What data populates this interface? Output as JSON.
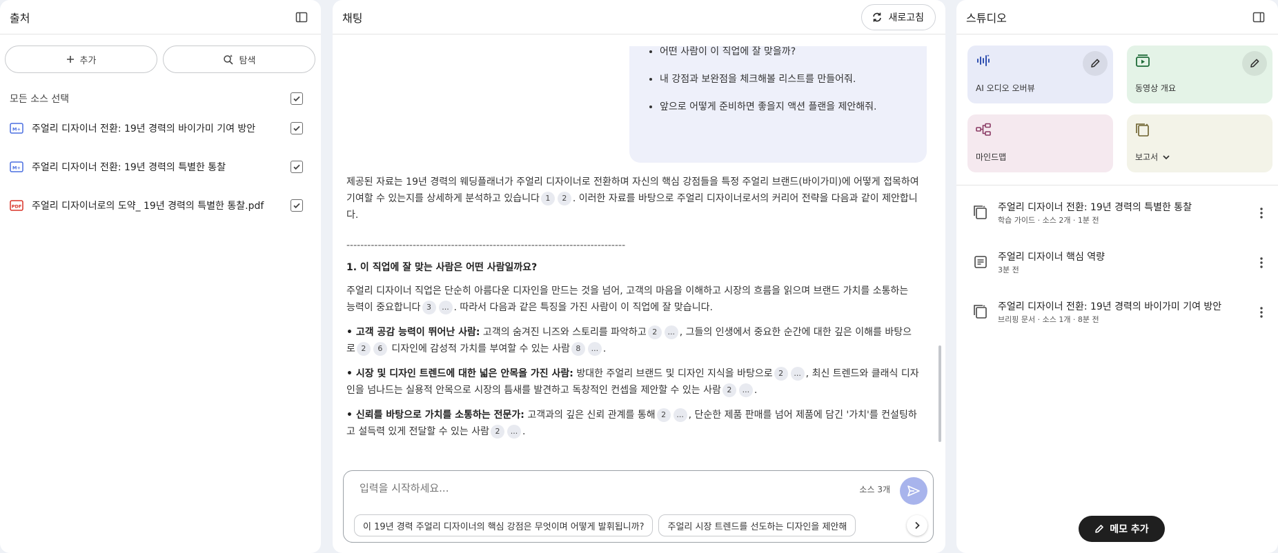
{
  "sources_panel": {
    "title": "출처",
    "add_label": "추가",
    "explore_label": "탐색",
    "select_all_label": "모든 소스 선택",
    "items": [
      {
        "name": "주얼리 디자이너 전환: 19년 경력의 바이가미 기여 방안",
        "type": "text",
        "type_label": "M+"
      },
      {
        "name": "주얼리 디자이너 전환: 19년 경력의 특별한 통찰",
        "type": "text",
        "type_label": "M+"
      },
      {
        "name": "주얼리 디자이너로의 도약_ 19년 경력의 특별한 통찰.pdf",
        "type": "pdf",
        "type_label": "PDF"
      }
    ]
  },
  "chat_panel": {
    "title": "채팅",
    "refresh_label": "새로고침",
    "user_message_items": [
      "어떤 사람이 이 직업에 잘 맞을까?",
      "내 강점과 보완점을 체크해볼 리스트를 만들어줘.",
      "앞으로 어떻게 준비하면 좋을지 액션 플랜을 제안해줘."
    ],
    "answer": {
      "intro_a": "제공된 자료는 19년 경력의 웨딩플래너가 주얼리 디자이너로 전환하며 자신의 핵심 강점들을 특정 주얼리 브랜드(바이가미)에 어떻게 접목하여 기여할 수 있는지를 상세하게 분석하고 있습니다",
      "intro_cites": [
        "1",
        "2"
      ],
      "intro_b": ". 이러한 자료를 바탕으로 주얼리 디자이너로서의 커리어 전략을 다음과 같이 제안합니다.",
      "divider": "--------------------------------------------------------------------------------",
      "section_heading": "1. 이 직업에 잘 맞는 사람은 어떤 사람일까요?",
      "section_intro_a": "주얼리 디자이너 직업은 단순히 아름다운 디자인을 만드는 것을 넘어, 고객의 마음을 이해하고 시장의 흐름을 읽으며 브랜드 가치를 소통하는 능력이 중요합니다",
      "section_intro_cites": [
        "3",
        "..."
      ],
      "section_intro_b": ". 따라서 다음과 같은 특징을 가진 사람이 이 직업에 잘 맞습니다.",
      "bullets": [
        {
          "title": "• 고객 공감 능력이 뛰어난 사람:",
          "t1": " 고객의 숨겨진 니즈와 스토리를 파악하고",
          "c1": [
            "2",
            "..."
          ],
          "t2": ", 그들의 인생에서 중요한 순간에 대한 깊은 이해를 바탕으로",
          "c2": [
            "2",
            "6"
          ],
          "t3": " 디자인에 감성적 가치를 부여할 수 있는 사람",
          "c3": [
            "8",
            "..."
          ],
          "t4": "."
        },
        {
          "title": "• 시장 및 디자인 트렌드에 대한 넓은 안목을 가진 사람:",
          "t1": " 방대한 주얼리 브랜드 및 디자인 지식을 바탕으로",
          "c1": [
            "2",
            "..."
          ],
          "t2": ", 최신 트렌드와 클래식 디자인을 넘나드는 실용적 안목으로 시장의 틈새를 발견하고 독창적인 컨셉을 제안할 수 있는 사람",
          "c2": [
            "2",
            "..."
          ],
          "t3": ".",
          "c3": [],
          "t4": ""
        },
        {
          "title": "• 신뢰를 바탕으로 가치를 소통하는 전문가:",
          "t1": " 고객과의 깊은 신뢰 관계를 통해",
          "c1": [
            "2",
            "..."
          ],
          "t2": ", 단순한 제품 판매를 넘어 제품에 담긴 '가치'를 컨설팅하고 설득력 있게 전달할 수 있는 사람",
          "c2": [
            "2",
            "..."
          ],
          "t3": ".",
          "c3": [],
          "t4": ""
        }
      ]
    },
    "composer": {
      "placeholder": "입력을 시작하세요...",
      "source_count": "소스 3개",
      "suggestions": [
        "이 19년 경력 주얼리 디자이너의 핵심 강점은 무엇이며 어떻게 발휘됩니까?",
        "주얼리 시장 트렌드를 선도하는 디자인을 제안해"
      ]
    }
  },
  "studio_panel": {
    "title": "스튜디오",
    "cards": [
      {
        "label": "AI 오디오 오버뷰",
        "icon": "audio-waveform-icon",
        "color": "#e8ebf8",
        "icon_color": "#2f4fb0",
        "has_edit": true
      },
      {
        "label": "동영상 개요",
        "icon": "video-icon",
        "color": "#e4f3e7",
        "icon_color": "#1e6b38",
        "has_edit": true
      },
      {
        "label": "마인드맵",
        "icon": "mindmap-icon",
        "color": "#f5e9ef",
        "icon_color": "#8a3a64",
        "has_edit": false
      },
      {
        "label": "보고서",
        "icon": "report-icon",
        "color": "#f3f3e8",
        "icon_color": "#6b5f2a",
        "has_edit": false
      }
    ],
    "notes": [
      {
        "title": "주얼리 디자이너 전환: 19년 경력의 특별한 통찰",
        "meta": "학습 가이드 · 소스 2개 · 1분 전",
        "icon": "study-guide-icon"
      },
      {
        "title": "주얼리 디자이너 핵심 역량",
        "meta": "3분 전",
        "icon": "note-icon"
      },
      {
        "title": "주얼리 디자이너 전환: 19년 경력의 바이가미 기여 방안",
        "meta": "브리핑 문서 · 소스 1개 · 8분 전",
        "icon": "study-guide-icon"
      }
    ],
    "memo_button_label": "메모 추가"
  }
}
